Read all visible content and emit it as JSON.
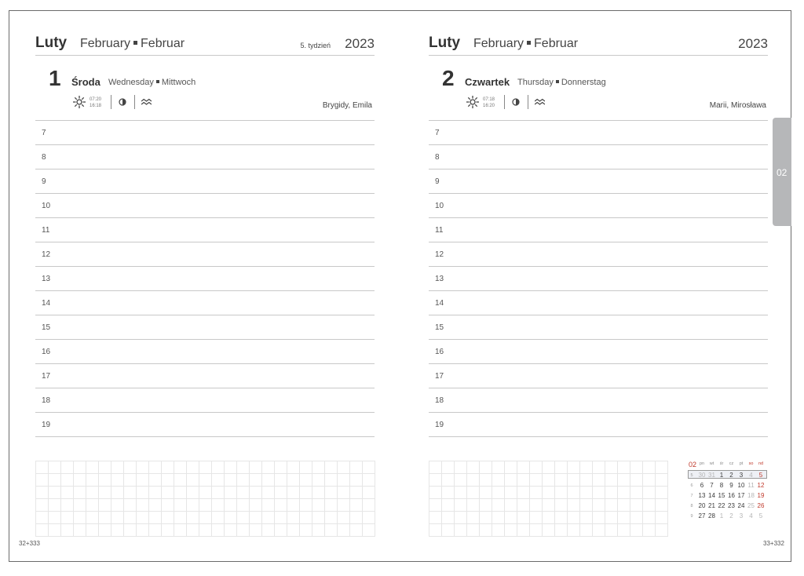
{
  "left": {
    "month_pl": "Luty",
    "month_en": "February",
    "month_de": "Februar",
    "week": "5. tydzień",
    "year": "2023",
    "day_number": "1",
    "day_name": "Środa",
    "day_en": "Wednesday",
    "day_de": "Mittwoch",
    "sunrise": "07:20",
    "sunset": "16:18",
    "names": "Brygidy, Emila",
    "page_number": "32+333"
  },
  "right": {
    "month_pl": "Luty",
    "month_en": "February",
    "month_de": "Februar",
    "year": "2023",
    "day_number": "2",
    "day_name": "Czwartek",
    "day_en": "Thursday",
    "day_de": "Donnerstag",
    "sunrise": "07:18",
    "sunset": "16:20",
    "names": "Marii, Mirosława",
    "page_number": "33+332"
  },
  "hours": [
    "7",
    "8",
    "9",
    "10",
    "11",
    "12",
    "13",
    "14",
    "15",
    "16",
    "17",
    "18",
    "19"
  ],
  "month_tab": "02",
  "mini_calendar": {
    "month": "02",
    "headers": [
      "pn",
      "wt",
      "śr",
      "cz",
      "pt",
      "so",
      "nd"
    ],
    "weeks": [
      {
        "wk": "5",
        "days": [
          "30",
          "31",
          "1",
          "2",
          "3",
          "4",
          "5"
        ]
      },
      {
        "wk": "6",
        "days": [
          "6",
          "7",
          "8",
          "9",
          "10",
          "11",
          "12"
        ]
      },
      {
        "wk": "7",
        "days": [
          "13",
          "14",
          "15",
          "16",
          "17",
          "18",
          "19"
        ]
      },
      {
        "wk": "8",
        "days": [
          "20",
          "21",
          "22",
          "23",
          "24",
          "25",
          "26"
        ]
      },
      {
        "wk": "9",
        "days": [
          "27",
          "28",
          "1",
          "2",
          "3",
          "4",
          "5"
        ]
      }
    ]
  },
  "colors": {
    "accent_red": "#c0392b",
    "tab_gray": "#b6b7b9"
  },
  "icons": [
    "sun-icon",
    "moon-icon",
    "tide-icon"
  ]
}
